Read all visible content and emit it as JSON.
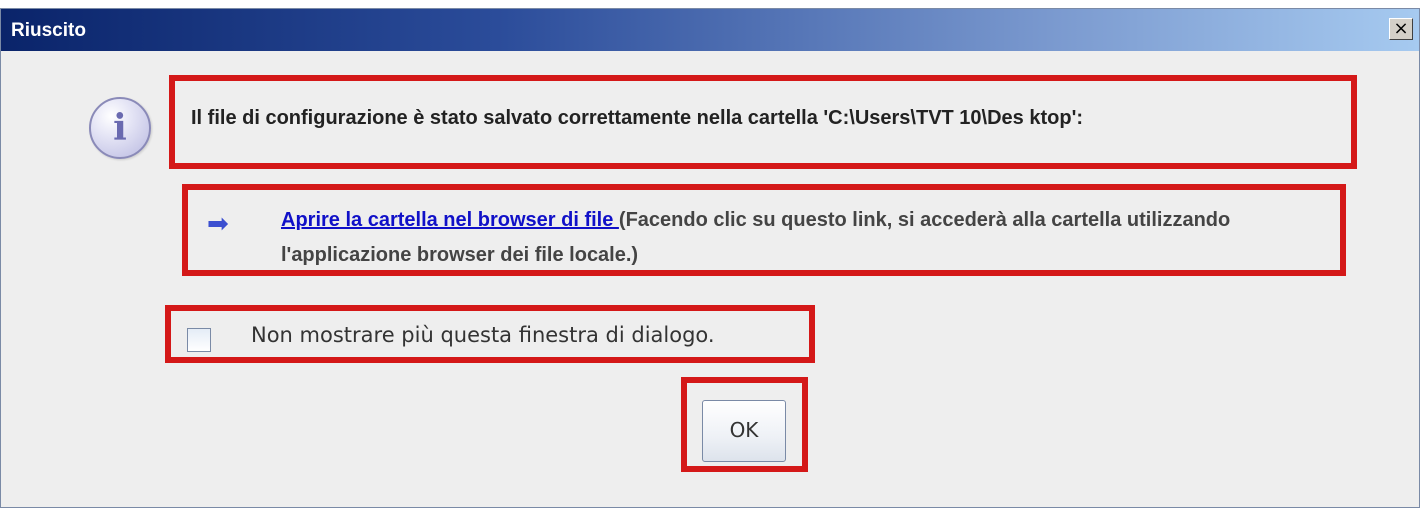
{
  "dialog": {
    "title": "Riuscito",
    "close_glyph": "×",
    "icon": "info-icon",
    "icon_glyph": "i",
    "message": "Il file di configurazione è stato salvato correttamente nella cartella 'C:\\Users\\TVT 10\\Des ktop':",
    "link_icon": "arrow-right-icon",
    "link_text": "Aprire la cartella nel browser di file ",
    "link_description": "(Facendo clic su questo link, si accederà alla cartella utilizzando l'applicazione browser dei file locale.)",
    "checkbox_label": "Non mostrare più questa finestra di dialogo.",
    "checkbox_checked": false,
    "ok_label": "OK"
  },
  "colors": {
    "highlight": "#d41818",
    "link": "#1010c8",
    "title_bar_start": "#0a246a",
    "title_bar_end": "#a6caf0"
  }
}
